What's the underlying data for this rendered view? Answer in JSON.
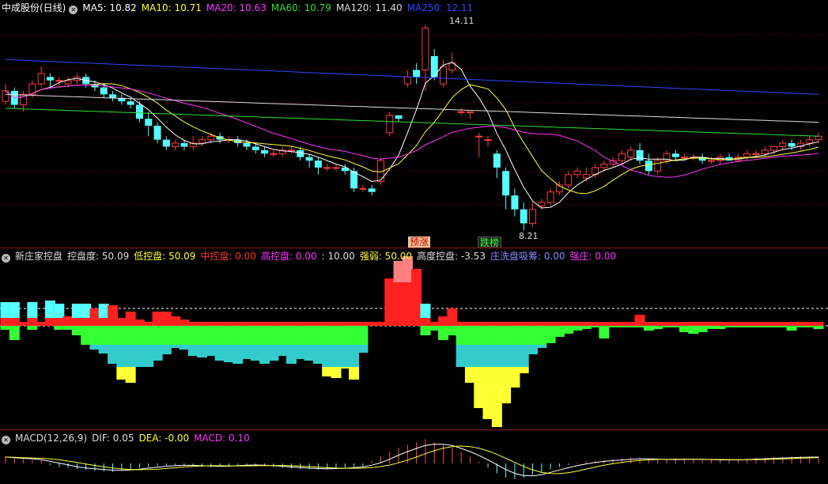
{
  "main_header": {
    "title": "中成股份(日线)",
    "ma_items": [
      {
        "label": "MA5: 10.82",
        "color": "#ffffff"
      },
      {
        "label": "MA10: 10.71",
        "color": "#ffff33"
      },
      {
        "label": "MA20: 10.63",
        "color": "#ff33ff"
      },
      {
        "label": "MA60: 10.79",
        "color": "#33dd33"
      },
      {
        "label": "MA120: 11.40",
        "color": "#dddddd"
      },
      {
        "label": "MA250: 12.11",
        "color": "#3344ff"
      }
    ]
  },
  "annotations": {
    "high_label": "14.11",
    "low_label": "8.21",
    "badge_up": "预涨",
    "badge_down": "跌榜"
  },
  "indicator_header": {
    "title": "新庄家控盘",
    "items": [
      {
        "label": "控盘度: 50.09",
        "color": "#dddddd"
      },
      {
        "label": "低控盘: 50.09",
        "color": "#ffff33"
      },
      {
        "label": "中控盘: 0.00",
        "color": "#ff3333"
      },
      {
        "label": "高控盘: 0.00",
        "color": "#ff33ff"
      },
      {
        "label": ": 10.00",
        "color": "#dddddd"
      },
      {
        "label": "强弱: 50.00",
        "color": "#ffff33"
      },
      {
        "label": "高度控盘: -3.53",
        "color": "#dddddd"
      },
      {
        "label": "庄洗盘吸筹: 0.00",
        "color": "#8888ff"
      },
      {
        "label": "强庄: 0.00",
        "color": "#ff33ff"
      }
    ]
  },
  "macd_header": {
    "title": "MACD(12,26,9)",
    "items": [
      {
        "label": "DIF: 0.05",
        "color": "#dddddd"
      },
      {
        "label": "DEA: -0.00",
        "color": "#ffff33"
      },
      {
        "label": "MACD: 0.10",
        "color": "#ff33ff"
      }
    ]
  },
  "chart_data": {
    "type": "candlestick",
    "candles": [
      [
        11.9,
        12.2,
        12.4,
        11.8
      ],
      [
        12.2,
        11.8,
        12.3,
        11.7
      ],
      [
        11.8,
        12.1,
        12.2,
        11.6
      ],
      [
        12.1,
        12.4,
        12.5,
        12.0
      ],
      [
        12.4,
        12.7,
        12.9,
        12.3
      ],
      [
        12.6,
        12.5,
        12.7,
        12.3
      ],
      [
        12.5,
        12.5,
        12.6,
        12.3
      ],
      [
        12.4,
        12.5,
        12.6,
        12.3
      ],
      [
        12.5,
        12.6,
        12.7,
        12.4
      ],
      [
        12.6,
        12.4,
        12.7,
        12.3
      ],
      [
        12.4,
        12.3,
        12.5,
        12.2
      ],
      [
        12.3,
        12.1,
        12.4,
        12.0
      ],
      [
        12.1,
        12.0,
        12.2,
        11.9
      ],
      [
        12.0,
        11.9,
        12.1,
        11.8
      ],
      [
        11.9,
        11.8,
        12.0,
        11.7
      ],
      [
        11.8,
        11.4,
        11.9,
        11.3
      ],
      [
        11.4,
        11.2,
        11.6,
        10.9
      ],
      [
        11.2,
        10.8,
        11.3,
        10.7
      ],
      [
        10.8,
        10.6,
        10.9,
        10.5
      ],
      [
        10.6,
        10.7,
        10.8,
        10.5
      ],
      [
        10.7,
        10.6,
        10.8,
        10.5
      ],
      [
        10.6,
        10.7,
        10.9,
        10.5
      ],
      [
        10.7,
        10.8,
        10.9,
        10.6
      ],
      [
        10.8,
        10.9,
        11.0,
        10.7
      ],
      [
        10.9,
        10.8,
        11.0,
        10.7
      ],
      [
        10.8,
        10.8,
        10.9,
        10.7
      ],
      [
        10.8,
        10.7,
        10.9,
        10.6
      ],
      [
        10.7,
        10.6,
        10.8,
        10.5
      ],
      [
        10.6,
        10.5,
        10.7,
        10.4
      ],
      [
        10.5,
        10.4,
        10.6,
        10.3
      ],
      [
        10.4,
        10.4,
        10.5,
        10.3
      ],
      [
        10.4,
        10.5,
        10.6,
        10.3
      ],
      [
        10.5,
        10.5,
        10.6,
        10.4
      ],
      [
        10.5,
        10.3,
        10.6,
        10.2
      ],
      [
        10.3,
        10.2,
        10.4,
        10.0
      ],
      [
        10.2,
        10.0,
        10.3,
        9.8
      ],
      [
        10.0,
        10.0,
        10.1,
        9.9
      ],
      [
        10.0,
        10.0,
        10.1,
        9.9
      ],
      [
        10.0,
        9.9,
        10.1,
        9.8
      ],
      [
        9.9,
        9.4,
        10.0,
        9.3
      ],
      [
        9.4,
        9.4,
        9.5,
        9.3
      ],
      [
        9.4,
        9.3,
        9.5,
        9.2
      ],
      [
        9.6,
        10.2,
        10.3,
        9.5
      ],
      [
        11.0,
        11.5,
        11.6,
        10.9
      ],
      [
        11.5,
        11.4,
        11.5,
        11.3
      ],
      [
        12.4,
        12.6,
        12.8,
        12.3
      ],
      [
        12.8,
        12.6,
        13.0,
        12.4
      ],
      [
        12.8,
        14.0,
        14.1,
        12.2
      ],
      [
        13.2,
        12.6,
        13.4,
        12.5
      ],
      [
        12.4,
        12.9,
        13.1,
        12.3
      ],
      [
        12.8,
        13.0,
        13.3,
        12.7
      ],
      [
        11.6,
        11.6,
        11.7,
        11.5
      ],
      [
        11.6,
        11.6,
        11.6,
        11.4
      ],
      [
        10.9,
        10.9,
        11.0,
        10.3
      ],
      [
        10.8,
        10.8,
        10.9,
        10.6
      ],
      [
        10.4,
        10.0,
        10.5,
        9.7
      ],
      [
        9.9,
        9.2,
        10.0,
        8.8
      ],
      [
        9.2,
        8.8,
        9.4,
        8.6
      ],
      [
        8.8,
        8.4,
        9.0,
        8.2
      ],
      [
        8.4,
        8.8,
        9.0,
        8.3
      ],
      [
        8.9,
        9.0,
        9.1,
        8.8
      ],
      [
        9.0,
        9.3,
        9.4,
        8.9
      ],
      [
        9.3,
        9.5,
        9.6,
        9.2
      ],
      [
        9.5,
        9.8,
        9.9,
        9.4
      ],
      [
        9.8,
        9.9,
        10.0,
        9.7
      ],
      [
        9.7,
        9.8,
        10.0,
        9.6
      ],
      [
        9.8,
        10.0,
        10.1,
        9.7
      ],
      [
        10.0,
        10.1,
        10.2,
        9.9
      ],
      [
        10.1,
        10.2,
        10.3,
        10.0
      ],
      [
        10.2,
        10.4,
        10.5,
        10.1
      ],
      [
        10.3,
        10.5,
        10.6,
        10.2
      ],
      [
        10.5,
        10.2,
        10.7,
        10.1
      ],
      [
        10.2,
        9.9,
        10.4,
        9.8
      ],
      [
        9.9,
        10.2,
        10.3,
        9.8
      ],
      [
        10.2,
        10.4,
        10.5,
        10.1
      ],
      [
        10.4,
        10.3,
        10.5,
        10.2
      ],
      [
        10.3,
        10.3,
        10.4,
        10.2
      ],
      [
        10.3,
        10.3,
        10.4,
        10.2
      ],
      [
        10.3,
        10.2,
        10.4,
        10.1
      ],
      [
        10.2,
        10.2,
        10.3,
        10.1
      ],
      [
        10.2,
        10.3,
        10.4,
        10.1
      ],
      [
        10.3,
        10.2,
        10.4,
        10.2
      ],
      [
        10.2,
        10.3,
        10.4,
        10.2
      ],
      [
        10.3,
        10.4,
        10.5,
        10.2
      ],
      [
        10.4,
        10.4,
        10.5,
        10.3
      ],
      [
        10.4,
        10.5,
        10.6,
        10.3
      ],
      [
        10.5,
        10.6,
        10.6,
        10.4
      ],
      [
        10.6,
        10.7,
        10.8,
        10.5
      ],
      [
        10.7,
        10.6,
        10.8,
        10.5
      ],
      [
        10.6,
        10.7,
        10.8,
        10.5
      ],
      [
        10.7,
        10.8,
        10.9,
        10.6
      ],
      [
        10.8,
        10.9,
        11.0,
        10.7
      ]
    ],
    "ind_top": [
      30,
      30,
      5,
      30,
      5,
      32,
      28,
      12,
      28,
      28,
      22,
      28,
      26,
      10,
      18,
      8,
      5,
      18,
      18,
      12,
      8,
      5,
      5,
      5,
      5,
      5,
      5,
      5,
      5,
      5,
      5,
      5,
      5,
      5,
      5,
      5,
      5,
      5,
      5,
      5,
      5,
      5,
      5,
      60,
      82,
      88,
      72,
      28,
      5,
      12,
      22,
      5,
      5,
      5,
      5,
      5,
      5,
      5,
      5,
      5,
      5,
      5,
      5,
      5,
      5,
      5,
      5,
      5,
      5,
      5,
      5,
      14,
      5,
      5,
      5,
      5,
      5,
      5,
      5,
      5,
      5,
      5,
      5,
      5,
      5,
      5,
      5,
      5,
      5,
      5,
      5,
      5
    ],
    "ind_bottom": [
      -5,
      -18,
      0,
      -5,
      0,
      0,
      -5,
      -5,
      -12,
      -24,
      -30,
      -35,
      -48,
      -68,
      -72,
      -52,
      -52,
      -44,
      -36,
      -28,
      -30,
      -38,
      -40,
      -38,
      -44,
      -46,
      -48,
      -42,
      -44,
      -48,
      -44,
      -38,
      -48,
      -42,
      -44,
      -48,
      -64,
      -66,
      -54,
      -68,
      -34,
      0,
      0,
      0,
      0,
      0,
      0,
      -12,
      -6,
      -18,
      -12,
      -52,
      -72,
      -104,
      -118,
      -128,
      -98,
      -78,
      -60,
      -36,
      -28,
      -22,
      -14,
      -10,
      -6,
      -4,
      -2,
      -16,
      -2,
      -2,
      -2,
      -2,
      -6,
      -4,
      -2,
      -2,
      -8,
      -10,
      -8,
      -4,
      -4,
      -2,
      -2,
      -2,
      -2,
      -2,
      -2,
      -2,
      -6,
      -2,
      -2,
      -4
    ],
    "macd": [
      0.1,
      0.08,
      0.06,
      0.05,
      0.04,
      -0.02,
      -0.05,
      -0.06,
      -0.08,
      -0.09,
      -0.1,
      -0.11,
      -0.12,
      -0.1,
      -0.08,
      -0.06,
      -0.05,
      -0.04,
      -0.03,
      -0.02,
      -0.03,
      -0.04,
      -0.05,
      -0.05,
      -0.04,
      -0.03,
      -0.02,
      -0.02,
      -0.03,
      -0.04,
      -0.05,
      -0.06,
      -0.07,
      -0.08,
      -0.08,
      -0.09,
      -0.08,
      -0.07,
      -0.06,
      -0.05,
      -0.04,
      0.04,
      0.1,
      0.16,
      0.22,
      0.26,
      0.3,
      0.34,
      0.3,
      0.26,
      0.22,
      0.16,
      0.1,
      0.02,
      -0.06,
      -0.14,
      -0.2,
      -0.22,
      -0.2,
      -0.16,
      -0.12,
      -0.08,
      -0.05,
      -0.02,
      0.01,
      0.03,
      0.04,
      0.05,
      0.06,
      0.07,
      0.08,
      0.08,
      0.06,
      0.05,
      0.06,
      0.07,
      0.07,
      0.06,
      0.06,
      0.05,
      0.05,
      0.06,
      0.06,
      0.07,
      0.08,
      0.08,
      0.09,
      0.09,
      0.1,
      0.1,
      0.1,
      0.1
    ]
  }
}
